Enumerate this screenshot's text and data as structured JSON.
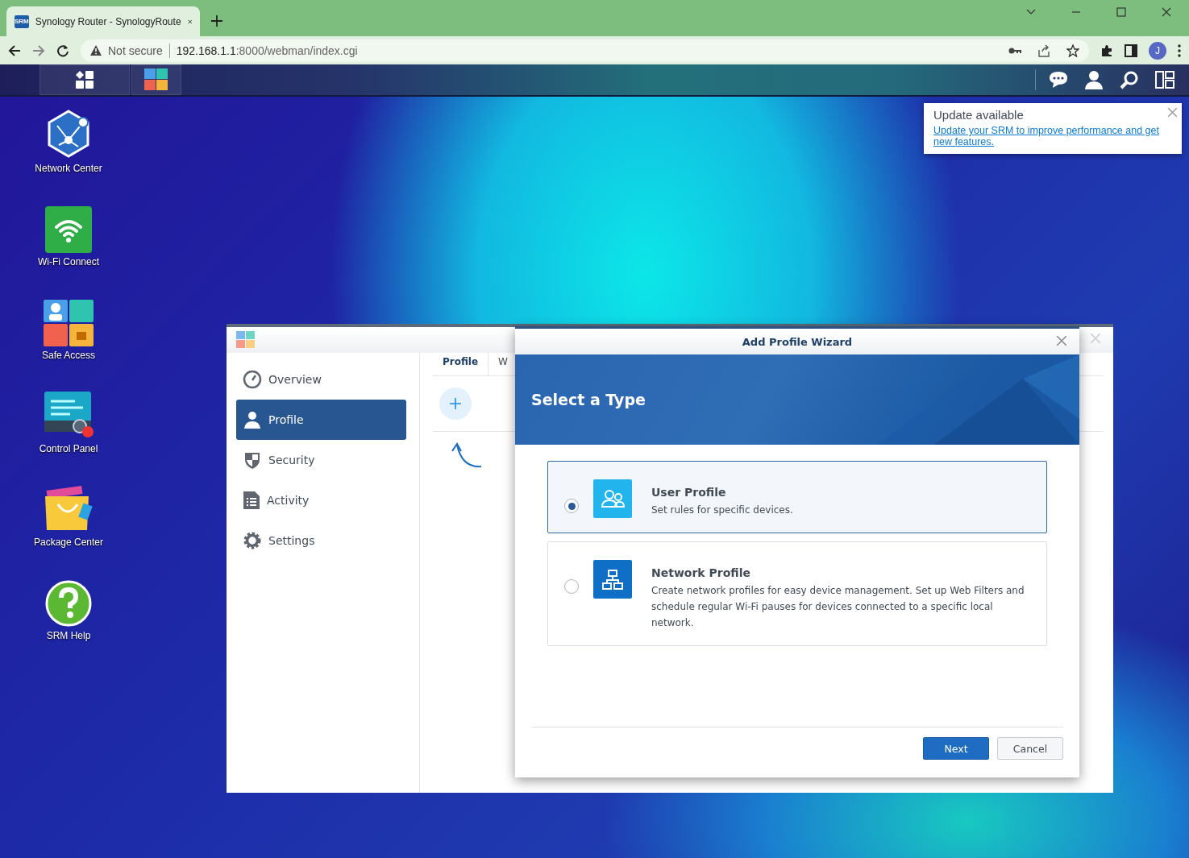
{
  "browser": {
    "tab": {
      "favicon": "SRM",
      "title": "Synology Router - SynologyRoute"
    },
    "address_bar": {
      "security": "Not secure",
      "url_host": "192.168.1.1",
      "url_rest": ":8000/webman/index.cgi"
    },
    "profile_initial": "J"
  },
  "desktop_icons": [
    {
      "kind": "network",
      "label": "Network Center"
    },
    {
      "kind": "wifi",
      "label": "Wi-Fi Connect"
    },
    {
      "kind": "safe",
      "label": "Safe Access"
    },
    {
      "kind": "control",
      "label": "Control Panel"
    },
    {
      "kind": "package",
      "label": "Package Center"
    },
    {
      "kind": "help",
      "label": "SRM Help"
    }
  ],
  "notification": {
    "title": "Update available",
    "link": "Update your SRM to improve performance and get new features."
  },
  "app_window": {
    "sidebar": [
      {
        "kind": "overview",
        "label": "Overview",
        "selected": false
      },
      {
        "kind": "profile",
        "label": "Profile",
        "selected": true
      },
      {
        "kind": "security",
        "label": "Security",
        "selected": false
      },
      {
        "kind": "activity",
        "label": "Activity",
        "selected": false
      },
      {
        "kind": "settings",
        "label": "Settings",
        "selected": false
      }
    ],
    "tabs": [
      {
        "label": "Profile",
        "selected": true
      },
      {
        "label": "W",
        "selected": false
      }
    ]
  },
  "wizard": {
    "title": "Add Profile Wizard",
    "heading": "Select a Type",
    "options": [
      {
        "kind": "user",
        "title": "User Profile",
        "description": "Set rules for specific devices.",
        "selected": true
      },
      {
        "kind": "network",
        "title": "Network Profile",
        "description": "Create network profiles for easy device management. Set up Web Filters and schedule regular Wi-Fi pauses for devices connected to a specific local network.",
        "selected": false
      }
    ],
    "buttons": [
      {
        "kind": "primary",
        "label": "Next"
      },
      {
        "kind": "secondary",
        "label": "Cancel"
      }
    ]
  }
}
